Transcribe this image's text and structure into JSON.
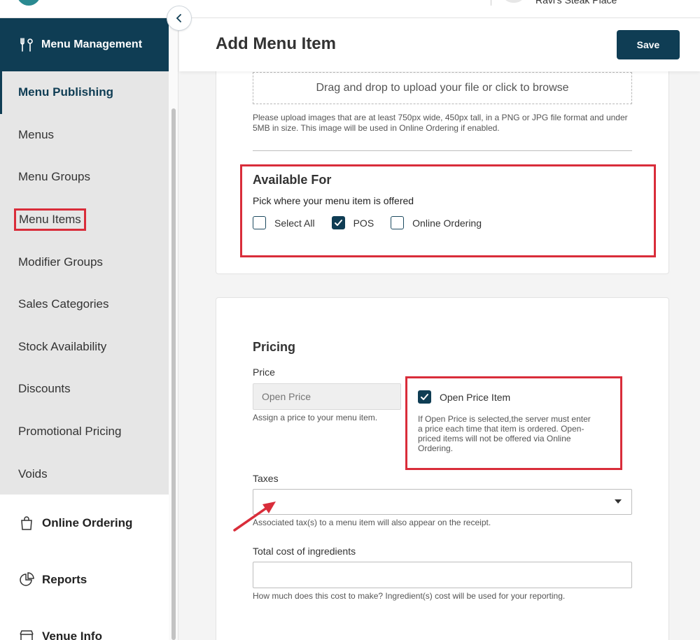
{
  "topbar": {
    "venue_name": "Ravi's Steak Place"
  },
  "sidebar": {
    "header": "Menu Management",
    "items": [
      {
        "label": "Menu Publishing"
      },
      {
        "label": "Menus"
      },
      {
        "label": "Menu Groups"
      },
      {
        "label": "Menu Items"
      },
      {
        "label": "Modifier Groups"
      },
      {
        "label": "Sales Categories"
      },
      {
        "label": "Stock Availability"
      },
      {
        "label": "Discounts"
      },
      {
        "label": "Promotional Pricing"
      },
      {
        "label": "Voids"
      }
    ],
    "main_nav": [
      {
        "label": "Online Ordering",
        "icon": "shopping-bag-icon"
      },
      {
        "label": "Reports",
        "icon": "pie-chart-icon"
      },
      {
        "label": "Venue Info",
        "icon": "storefront-icon"
      }
    ]
  },
  "header": {
    "title": "Add Menu Item",
    "save_label": "Save"
  },
  "upload": {
    "dropzone_text": "Drag and drop to upload your file or click to browse",
    "help": "Please upload images that are at least 750px wide, 450px tall, in a PNG or JPG file format and under 5MB in size. This image will be used in Online Ordering if enabled."
  },
  "available_for": {
    "title": "Available For",
    "subtitle": "Pick where your menu item is offered",
    "options": [
      {
        "label": "Select All",
        "checked": false
      },
      {
        "label": "POS",
        "checked": true
      },
      {
        "label": "Online Ordering",
        "checked": false
      }
    ]
  },
  "pricing": {
    "title": "Pricing",
    "price_label": "Price",
    "price_placeholder": "Open Price",
    "price_help": "Assign a price to your menu item.",
    "open_price_label": "Open Price Item",
    "open_price_checked": true,
    "open_price_desc": "If Open Price is selected,the server must enter a price each time that item is ordered. Open-priced items will not be offered via Online Ordering.",
    "taxes_label": "Taxes",
    "taxes_value": "",
    "taxes_help": "Associated tax(s) to a menu item will also appear on the receipt.",
    "cost_label": "Total cost of ingredients",
    "cost_value": "",
    "cost_help": "How much does this cost to make? Ingredient(s) cost will be used for your reporting."
  },
  "colors": {
    "brand": "#0f3d54",
    "highlight": "#d92d3a"
  }
}
